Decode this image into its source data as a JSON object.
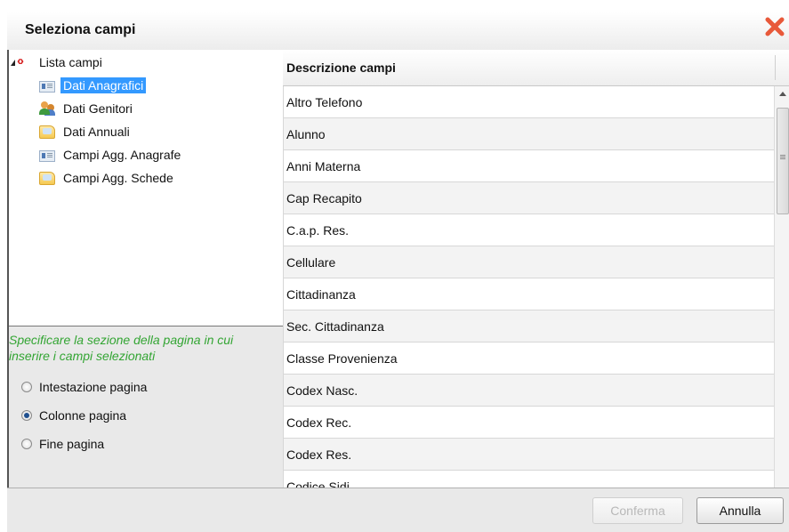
{
  "dialog": {
    "title": "Seleziona campi",
    "close_icon": "close-x-icon",
    "close_color": "#e8593a"
  },
  "tree": {
    "root": {
      "label": "Lista campi",
      "icon": "root-code-icon",
      "expanded": true
    },
    "items": [
      {
        "label": "Dati Anagrafici",
        "icon": "id-card-icon",
        "selected": true
      },
      {
        "label": "Dati Genitori",
        "icon": "people-icon",
        "selected": false
      },
      {
        "label": "Dati Annuali",
        "icon": "folder-icon",
        "selected": false
      },
      {
        "label": "Campi Agg. Anagrafe",
        "icon": "id-card-icon",
        "selected": false
      },
      {
        "label": "Campi Agg. Schede",
        "icon": "folder-icon",
        "selected": false
      }
    ]
  },
  "options": {
    "hint": "Specificare la sezione della pagina in cui inserire i campi selezionati",
    "hint_color": "#33a533",
    "radios": [
      {
        "label": "Intestazione pagina",
        "checked": false
      },
      {
        "label": "Colonne pagina",
        "checked": true
      },
      {
        "label": "Fine pagina",
        "checked": false
      }
    ]
  },
  "grid": {
    "header": "Descrizione campi",
    "rows": [
      "Altro Telefono",
      "Alunno",
      "Anni Materna",
      "Cap Recapito",
      "C.a.p. Res.",
      "Cellulare",
      "Cittadinanza",
      "Sec. Cittadinanza",
      "Classe Provenienza",
      "Codex Nasc.",
      "Codex Rec.",
      "Codex Res.",
      "Codice Sidi"
    ]
  },
  "footer": {
    "confirm_label": "Conferma",
    "confirm_enabled": false,
    "cancel_label": "Annulla"
  }
}
